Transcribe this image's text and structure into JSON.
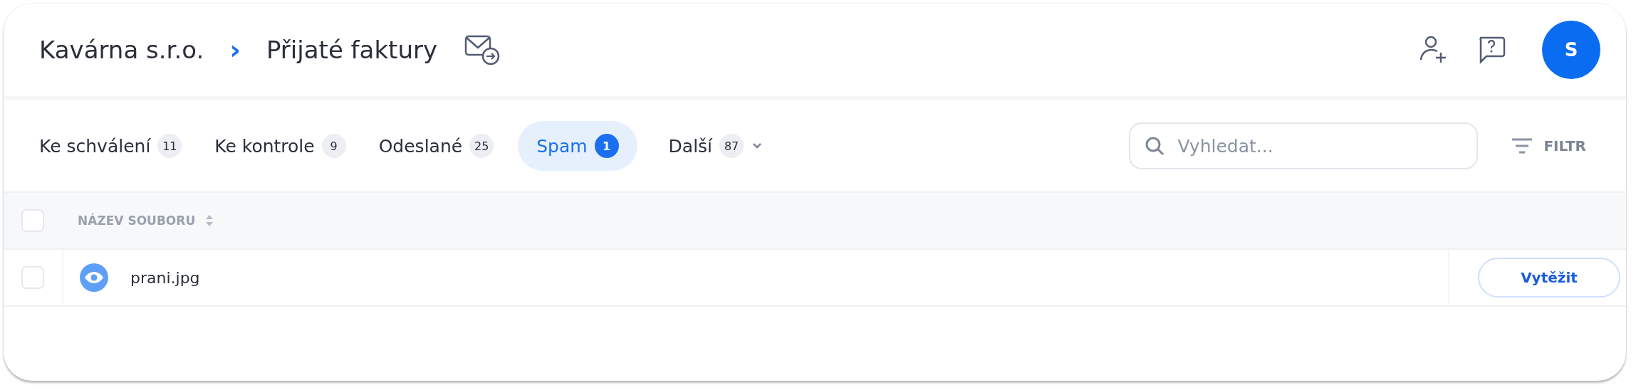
{
  "breadcrumb": {
    "company": "Kavárna s.r.o.",
    "separator": "›",
    "page": "Přijaté faktury"
  },
  "avatar": {
    "initial": "S"
  },
  "tabs": [
    {
      "label": "Ke schválení",
      "count": "11",
      "selected": false,
      "dropdown": false
    },
    {
      "label": "Ke kontrole",
      "count": "9",
      "selected": false,
      "dropdown": false
    },
    {
      "label": "Odeslané",
      "count": "25",
      "selected": false,
      "dropdown": false
    },
    {
      "label": "Spam",
      "count": "1",
      "selected": true,
      "dropdown": false
    },
    {
      "label": "Další",
      "count": "87",
      "selected": false,
      "dropdown": true
    }
  ],
  "search": {
    "placeholder": "Vyhledat..."
  },
  "filter": {
    "label": "FILTR"
  },
  "table": {
    "columns": [
      {
        "label": "NÁZEV SOUBORU",
        "sortable": true
      }
    ],
    "header_checked": false,
    "rows": [
      {
        "file": "prani.jpg",
        "checked": false,
        "action": "Vytěžit"
      }
    ]
  }
}
